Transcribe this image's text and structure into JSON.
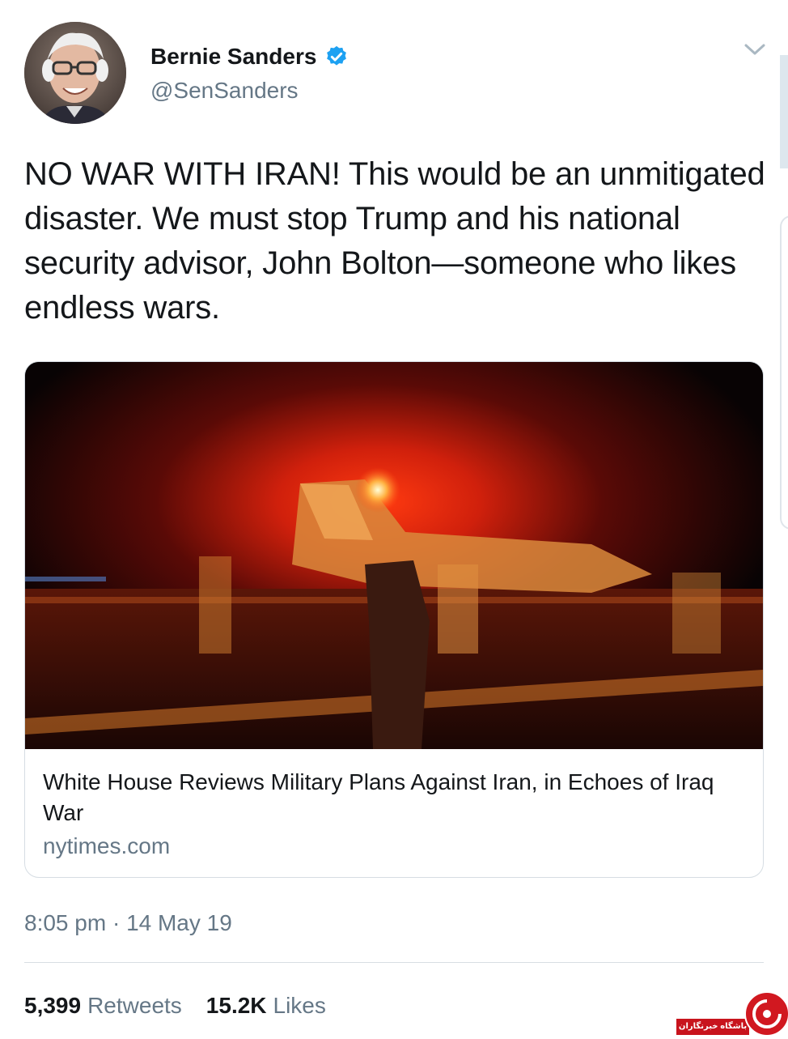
{
  "author": {
    "display_name": "Bernie Sanders",
    "handle": "@SenSanders",
    "verified_icon": "verified-badge-icon"
  },
  "tweet": {
    "text": "NO WAR WITH IRAN! This would be an unmitigated disaster. We must stop Trump and his national security advisor, John Bolton—someone who likes endless wars."
  },
  "card": {
    "title": "White House Reviews Military Plans Against Iran, in Echoes of Iraq War",
    "domain": "nytimes.com",
    "image": "night-aircraft-carrier-jet-photo"
  },
  "meta": {
    "time": "8:05 pm",
    "separator": "·",
    "date": "14 May 19"
  },
  "stats": {
    "retweets_count": "5,399",
    "retweets_label": "Retweets",
    "likes_count": "15.2K",
    "likes_label": "Likes"
  },
  "watermark": {
    "text": "باشگاه خبرنگاران"
  },
  "colors": {
    "text_primary": "#14171a",
    "text_secondary": "#657786",
    "verified_blue": "#1da1f2",
    "watermark_red": "#c8141d"
  }
}
